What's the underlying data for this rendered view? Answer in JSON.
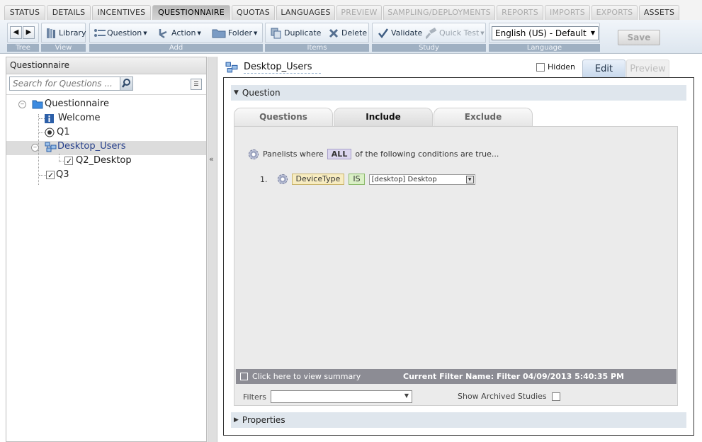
{
  "top_tabs": [
    {
      "label": "STATUS"
    },
    {
      "label": "DETAILS"
    },
    {
      "label": "INCENTIVES"
    },
    {
      "label": "QUESTIONNAIRE"
    },
    {
      "label": "QUOTAS"
    },
    {
      "label": "LANGUAGES"
    },
    {
      "label": "PREVIEW"
    },
    {
      "label": "SAMPLING/DEPLOYMENTS"
    },
    {
      "label": "REPORTS"
    },
    {
      "label": "IMPORTS"
    },
    {
      "label": "EXPORTS"
    },
    {
      "label": "ASSETS"
    }
  ],
  "toolbar": {
    "tree_label": "Tree",
    "view_label": "View",
    "add_label": "Add",
    "items_label": "Items",
    "study_label": "Study",
    "language_label": "Language",
    "library": "Library",
    "question": "Question",
    "action": "Action",
    "folder": "Folder",
    "duplicate": "Duplicate",
    "delete": "Delete",
    "validate": "Validate",
    "quick_test": "Quick Test",
    "language_value": "English (US) - Default",
    "save": "Save"
  },
  "left_panel": {
    "title": "Questionnaire",
    "search_placeholder": "Search for Questions ...",
    "tree": {
      "root": "Questionnaire",
      "welcome": "Welcome",
      "q1": "Q1",
      "desktop_users": "Desktop_Users",
      "q2_desktop": "Q2_Desktop",
      "q3": "Q3"
    }
  },
  "question_header": {
    "title": "Desktop_Users",
    "hidden_label": "Hidden",
    "edit_tab": "Edit",
    "preview_tab": "Preview"
  },
  "question_section": {
    "label": "Question",
    "subtabs": [
      "Questions",
      "Include",
      "Exclude"
    ],
    "condition_prefix": "Panelists where",
    "all_label": "ALL",
    "condition_suffix": "of the following conditions are true...",
    "rule_number": "1.",
    "rule_field": "DeviceType",
    "rule_operator": "IS",
    "rule_value": "[desktop] Desktop",
    "summary_link": "Click here to view summary",
    "filter_name": "Current Filter Name: Filter 04/09/2013 5:40:35 PM",
    "filters_label": "Filters",
    "show_archived_label": "Show Archived Studies"
  },
  "properties_section": {
    "label": "Properties"
  },
  "colors": {
    "accent_blue": "#27408b",
    "toolbar_label_bg": "#9fb0c2",
    "summary_bar": "#8c8c94"
  }
}
